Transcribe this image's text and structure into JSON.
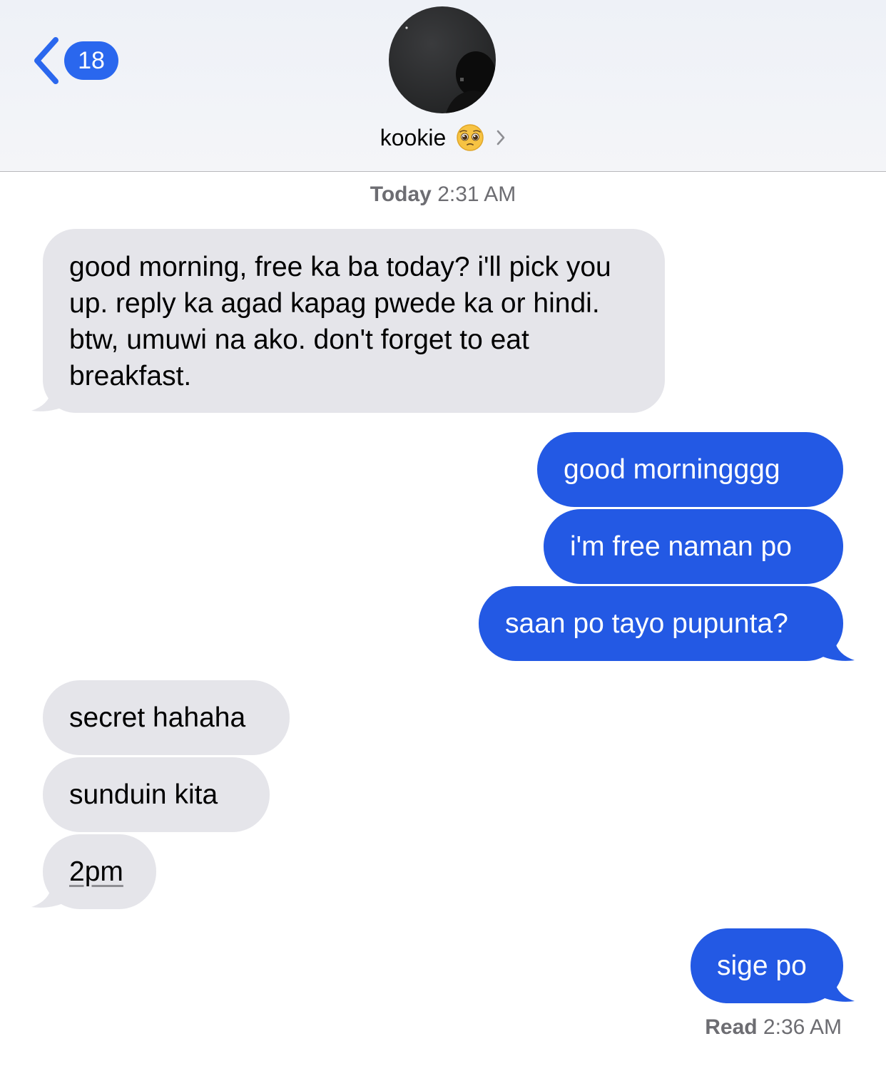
{
  "header": {
    "back_count": "18",
    "contact_name": "kookie",
    "contact_emoji": "pleading-face-emoji"
  },
  "thread": {
    "timestamp_day": "Today",
    "timestamp_time": "2:31 AM",
    "messages": [
      {
        "from": "them",
        "text": "good morning, free ka ba today? i'll pick you up. reply ka agad kapag pwede ka or hindi. btw, umuwi na ako. don't forget to eat breakfast."
      },
      {
        "from": "me",
        "text": "good morningggg"
      },
      {
        "from": "me",
        "text": "i'm free naman po"
      },
      {
        "from": "me",
        "text": "saan po tayo pupunta?"
      },
      {
        "from": "them",
        "text": "secret hahaha"
      },
      {
        "from": "them",
        "text": "sunduin kita"
      },
      {
        "from": "them",
        "text": "2pm"
      },
      {
        "from": "me",
        "text": "sige po"
      }
    ],
    "receipt_label": "Read",
    "receipt_time": "2:36 AM"
  },
  "colors": {
    "incoming": "#e5e5ea",
    "outgoing": "#2359e4",
    "accent": "#2a67ee"
  }
}
